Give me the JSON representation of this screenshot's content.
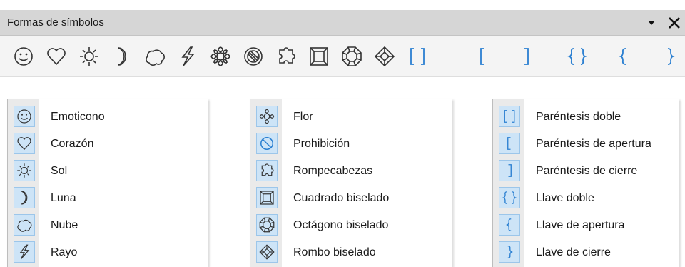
{
  "window": {
    "title": "Formas de símbolos"
  },
  "toolbar": {
    "buttons": [
      "smiley-icon",
      "heart-icon",
      "sun-icon",
      "moon-icon",
      "cloud-icon",
      "lightning-icon",
      "flower-icon",
      "prohibition-icon",
      "puzzle-icon",
      "bevel-square-icon",
      "bevel-octagon-icon",
      "bevel-diamond-icon",
      "double-bracket-icon",
      "left-bracket-icon",
      "right-bracket-icon",
      "double-brace-icon",
      "left-brace-icon",
      "right-brace-icon"
    ]
  },
  "menus": [
    {
      "items": [
        {
          "label": "Emoticono",
          "icon": "smiley-icon"
        },
        {
          "label": "Corazón",
          "icon": "heart-icon"
        },
        {
          "label": "Sol",
          "icon": "sun-icon"
        },
        {
          "label": "Luna",
          "icon": "moon-icon"
        },
        {
          "label": "Nube",
          "icon": "cloud-icon"
        },
        {
          "label": "Rayo",
          "icon": "lightning-icon"
        }
      ]
    },
    {
      "items": [
        {
          "label": "Flor",
          "icon": "flower-icon"
        },
        {
          "label": "Prohibición",
          "icon": "prohibition-icon"
        },
        {
          "label": "Rompecabezas",
          "icon": "puzzle-icon"
        },
        {
          "label": "Cuadrado biselado",
          "icon": "bevel-square-icon"
        },
        {
          "label": "Octágono biselado",
          "icon": "bevel-octagon-icon"
        },
        {
          "label": "Rombo biselado",
          "icon": "bevel-diamond-icon"
        }
      ]
    },
    {
      "items": [
        {
          "label": "Paréntesis doble",
          "icon": "double-bracket-icon"
        },
        {
          "label": "Paréntesis de apertura",
          "icon": "left-bracket-icon"
        },
        {
          "label": "Paréntesis de cierre",
          "icon": "right-bracket-icon"
        },
        {
          "label": "Llave doble",
          "icon": "double-brace-icon"
        },
        {
          "label": "Llave de apertura",
          "icon": "left-brace-icon"
        },
        {
          "label": "Llave de cierre",
          "icon": "right-brace-icon"
        }
      ]
    }
  ],
  "colors": {
    "accent": "#2a7fd1",
    "highlight": "#cde4f7",
    "titlebar": "#d6d6d6"
  }
}
